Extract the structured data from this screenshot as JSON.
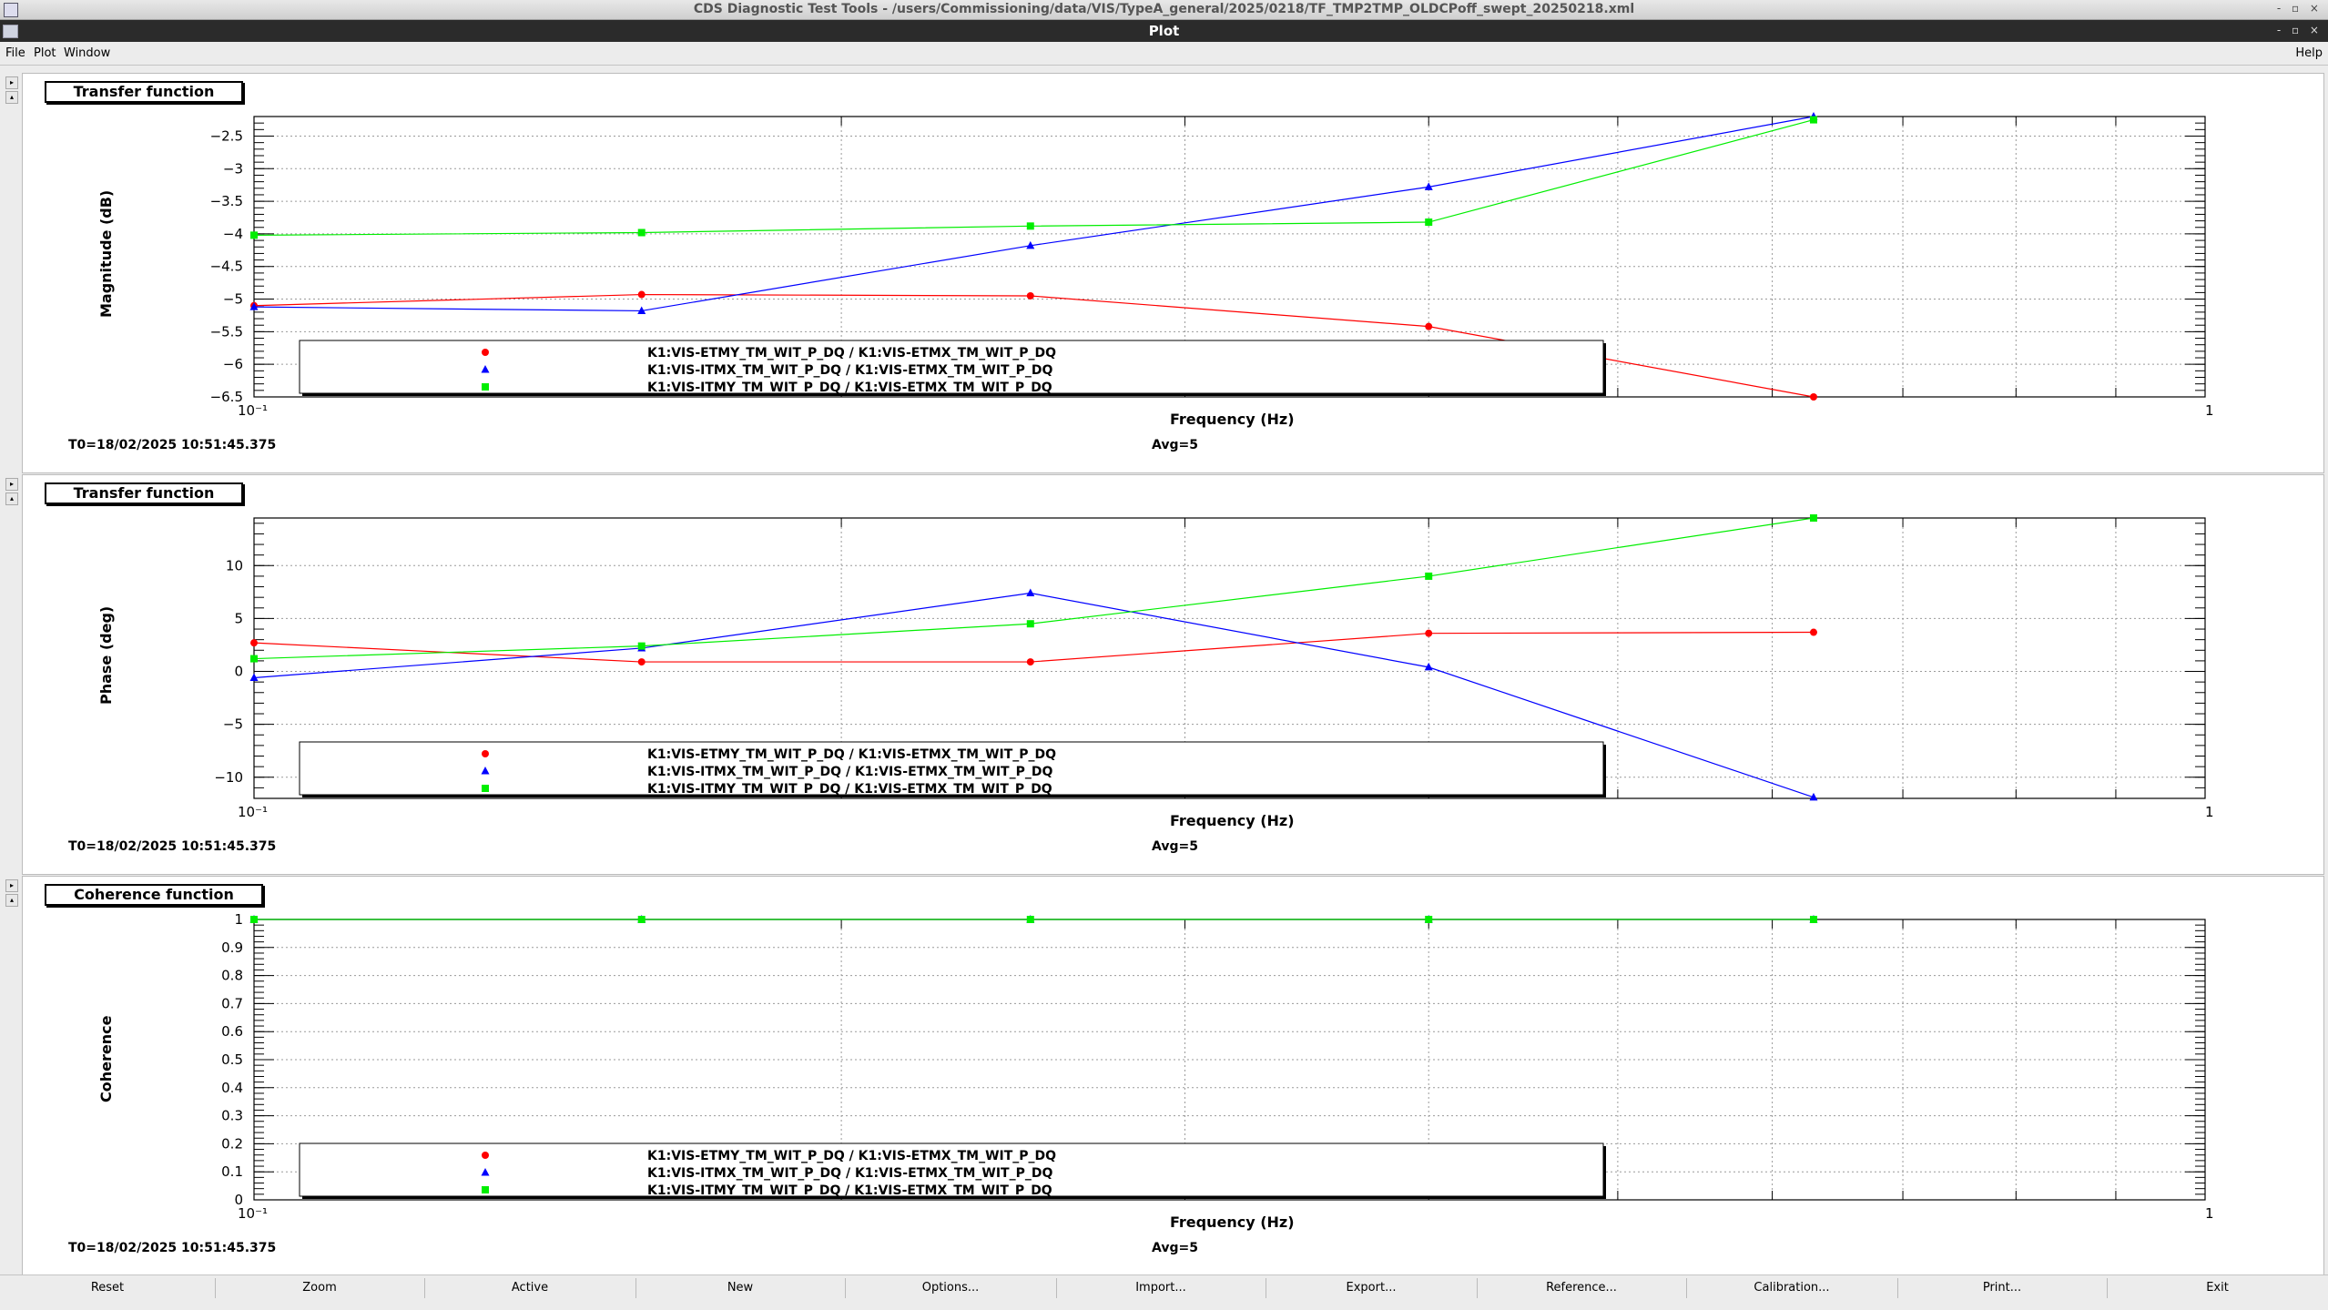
{
  "window": {
    "title": "CDS Diagnostic Test Tools - /users/Commissioning/data/VIS/TypeA_general/2025/0218/TF_TMP2TMP_OLDCPoff_swept_20250218.xml",
    "subtitle": "Plot",
    "controls": "- ▫ ×"
  },
  "menu": {
    "file": "File",
    "plot": "Plot",
    "window": "Window",
    "help": "Help"
  },
  "colors": {
    "series1": "#ff0000",
    "series2": "#0000ff",
    "series3": "#00ee00"
  },
  "panels": [
    {
      "title": "Transfer function",
      "ylabel": "Magnitude (dB)",
      "xlabel": "Frequency (Hz)",
      "t0": "T0=18/02/2025 10:51:45.375",
      "avg": "Avg=5"
    },
    {
      "title": "Transfer function",
      "ylabel": "Phase (deg)",
      "xlabel": "Frequency (Hz)",
      "t0": "T0=18/02/2025 10:51:45.375",
      "avg": "Avg=5"
    },
    {
      "title": "Coherence function",
      "ylabel": "Coherence",
      "xlabel": "Frequency (Hz)",
      "t0": "T0=18/02/2025 10:51:45.375",
      "avg": "Avg=5"
    }
  ],
  "legend": [
    "K1:VIS-ETMY_TM_WIT_P_DQ / K1:VIS-ETMX_TM_WIT_P_DQ",
    "K1:VIS-ITMX_TM_WIT_P_DQ / K1:VIS-ETMX_TM_WIT_P_DQ",
    "K1:VIS-ITMY_TM_WIT_P_DQ / K1:VIS-ETMX_TM_WIT_P_DQ"
  ],
  "chart_data": [
    {
      "type": "line",
      "title": "Transfer function",
      "xlabel": "Frequency (Hz)",
      "ylabel": "Magnitude (dB)",
      "xscale": "log",
      "xlim": [
        0.1,
        1
      ],
      "ylim": [
        -6.5,
        -2.2
      ],
      "yticks": [
        -2.5,
        -3,
        -3.5,
        -4,
        -4.5,
        -5,
        -5.5,
        -6,
        -6.5
      ],
      "ytick_labels": [
        "−2.5",
        "−3",
        "−3.5",
        "−4",
        "−4.5",
        "−5",
        "−5.5",
        "−6",
        "−6.5"
      ],
      "xtick_labels": [
        "10⁻¹",
        "1"
      ],
      "grid": true,
      "legend_position": "bottom-left",
      "x": [
        0.1,
        0.158,
        0.25,
        0.4,
        0.63
      ],
      "series": [
        {
          "name": "K1:VIS-ETMY_TM_WIT_P_DQ / K1:VIS-ETMX_TM_WIT_P_DQ",
          "marker": "circle",
          "values": [
            -5.1,
            -4.93,
            -4.95,
            -5.42,
            -6.55
          ]
        },
        {
          "name": "K1:VIS-ITMX_TM_WIT_P_DQ / K1:VIS-ETMX_TM_WIT_P_DQ",
          "marker": "triangle",
          "values": [
            -5.12,
            -5.18,
            -4.18,
            -3.28,
            -2.2
          ]
        },
        {
          "name": "K1:VIS-ITMY_TM_WIT_P_DQ / K1:VIS-ETMX_TM_WIT_P_DQ",
          "marker": "square",
          "values": [
            -4.02,
            -3.98,
            -3.88,
            -3.82,
            -2.25
          ]
        }
      ]
    },
    {
      "type": "line",
      "title": "Transfer function",
      "xlabel": "Frequency (Hz)",
      "ylabel": "Phase (deg)",
      "xscale": "log",
      "xlim": [
        0.1,
        1
      ],
      "ylim": [
        -12,
        14.5
      ],
      "yticks": [
        10,
        5,
        0,
        -5,
        -10
      ],
      "ytick_labels": [
        "10",
        "5",
        "0",
        "−5",
        "−10"
      ],
      "xtick_labels": [
        "10⁻¹",
        "1"
      ],
      "grid": true,
      "legend_position": "bottom-left",
      "x": [
        0.1,
        0.158,
        0.25,
        0.4,
        0.63
      ],
      "series": [
        {
          "name": "K1:VIS-ETMY_TM_WIT_P_DQ / K1:VIS-ETMX_TM_WIT_P_DQ",
          "marker": "circle",
          "values": [
            2.7,
            0.9,
            0.9,
            3.6,
            3.7
          ]
        },
        {
          "name": "K1:VIS-ITMX_TM_WIT_P_DQ / K1:VIS-ETMX_TM_WIT_P_DQ",
          "marker": "triangle",
          "values": [
            -0.6,
            2.2,
            7.4,
            0.4,
            -11.9
          ]
        },
        {
          "name": "K1:VIS-ITMY_TM_WIT_P_DQ / K1:VIS-ETMX_TM_WIT_P_DQ",
          "marker": "square",
          "values": [
            1.2,
            2.4,
            4.5,
            9.0,
            14.5
          ]
        }
      ]
    },
    {
      "type": "line",
      "title": "Coherence function",
      "xlabel": "Frequency (Hz)",
      "ylabel": "Coherence",
      "xscale": "log",
      "xlim": [
        0.1,
        1
      ],
      "ylim": [
        0,
        1
      ],
      "yticks": [
        1,
        0.9,
        0.8,
        0.7,
        0.6,
        0.5,
        0.4,
        0.3,
        0.2,
        0.1,
        0
      ],
      "ytick_labels": [
        "1",
        "0.9",
        "0.8",
        "0.7",
        "0.6",
        "0.5",
        "0.4",
        "0.3",
        "0.2",
        "0.1",
        "0"
      ],
      "xtick_labels": [
        "10⁻¹",
        "1"
      ],
      "grid": true,
      "legend_position": "bottom-left",
      "x": [
        0.1,
        0.158,
        0.25,
        0.4,
        0.63
      ],
      "series": [
        {
          "name": "K1:VIS-ETMY_TM_WIT_P_DQ / K1:VIS-ETMX_TM_WIT_P_DQ",
          "marker": "circle",
          "values": [
            1,
            1,
            1,
            1,
            1
          ]
        },
        {
          "name": "K1:VIS-ITMX_TM_WIT_P_DQ / K1:VIS-ETMX_TM_WIT_P_DQ",
          "marker": "triangle",
          "values": [
            1,
            1,
            1,
            1,
            1
          ]
        },
        {
          "name": "K1:VIS-ITMY_TM_WIT_P_DQ / K1:VIS-ETMX_TM_WIT_P_DQ",
          "marker": "square",
          "values": [
            1,
            1,
            1,
            1,
            1
          ]
        }
      ]
    }
  ],
  "buttons": [
    "Reset",
    "Zoom",
    "Active",
    "New",
    "Options...",
    "Import...",
    "Export...",
    "Reference...",
    "Calibration...",
    "Print...",
    "Exit"
  ]
}
